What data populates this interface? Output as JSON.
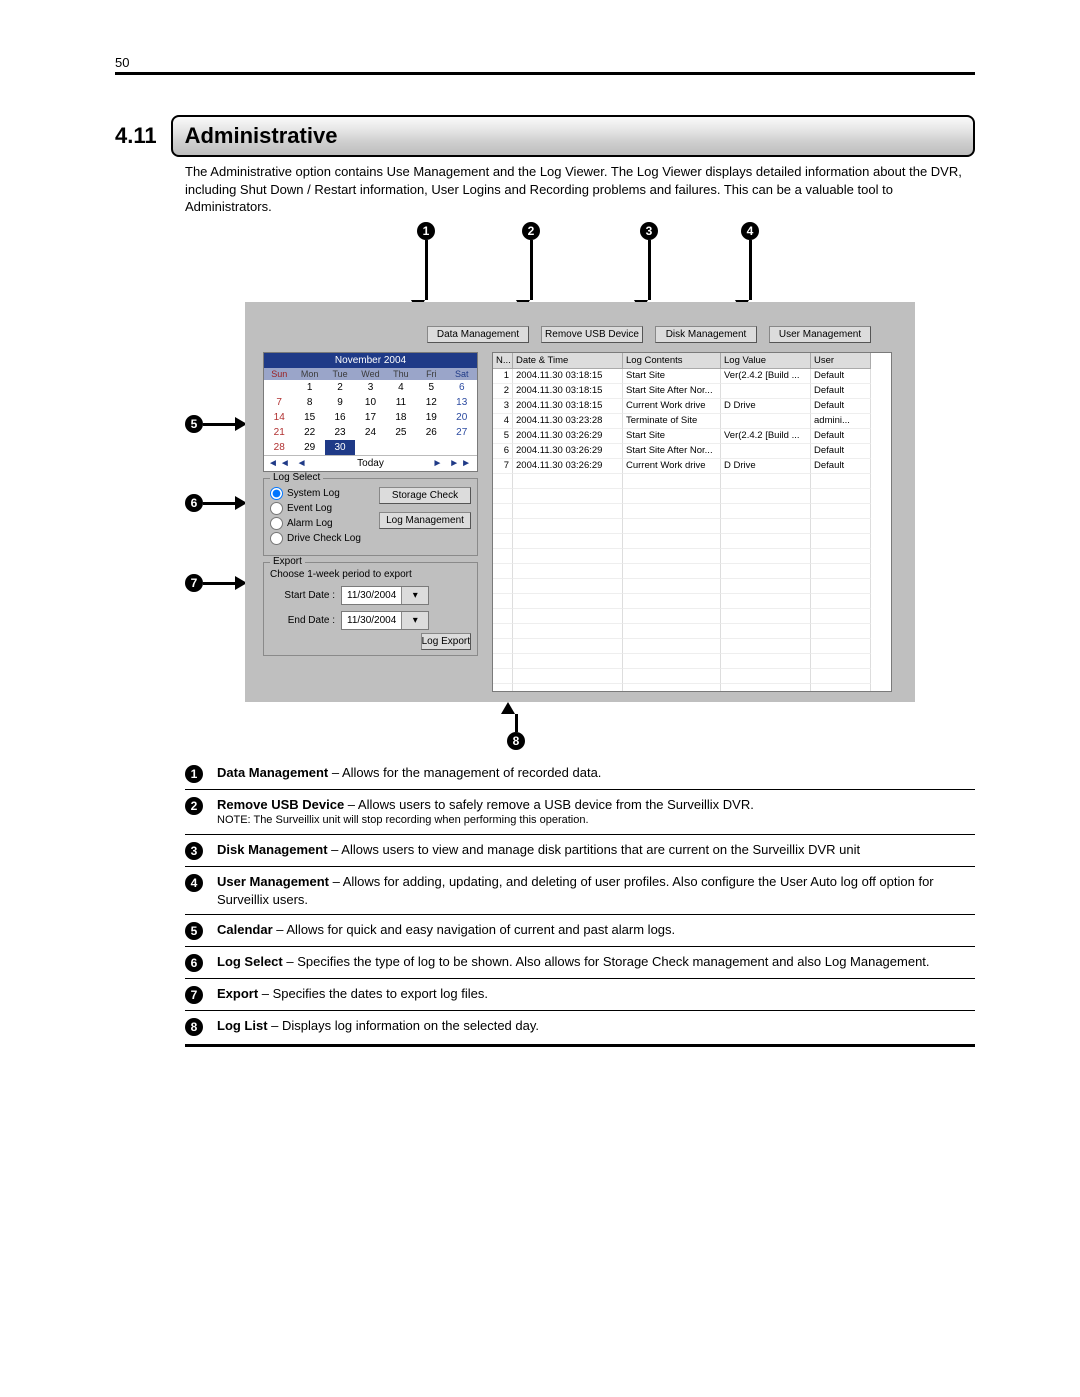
{
  "page_number": "50",
  "heading": {
    "num": "4.11",
    "title": "Administrative"
  },
  "intro": "The Administrative option contains Use Management and the Log Viewer. The Log Viewer displays detailed information about the DVR, including Shut Down / Restart information, User Logins and Recording problems and failures. This can be a valuable tool to Administrators.",
  "callouts_top": [
    "1",
    "2",
    "3",
    "4"
  ],
  "callouts_left": [
    "5",
    "6",
    "7"
  ],
  "callout_bottom": "8",
  "top_buttons": [
    "Data Management",
    "Remove USB Device",
    "Disk Management",
    "User Management"
  ],
  "calendar": {
    "title": "November 2004",
    "dow": [
      "Sun",
      "Mon",
      "Tue",
      "Wed",
      "Thu",
      "Fri",
      "Sat"
    ],
    "rows": [
      [
        "",
        "1",
        "2",
        "3",
        "4",
        "5",
        "6"
      ],
      [
        "7",
        "8",
        "9",
        "10",
        "11",
        "12",
        "13"
      ],
      [
        "14",
        "15",
        "16",
        "17",
        "18",
        "19",
        "20"
      ],
      [
        "21",
        "22",
        "23",
        "24",
        "25",
        "26",
        "27"
      ],
      [
        "28",
        "29",
        "30",
        "",
        "",
        "",
        ""
      ]
    ],
    "selected": "30",
    "today_label": "Today"
  },
  "log_select": {
    "title": "Log Select",
    "options": [
      "System Log",
      "Event Log",
      "Alarm Log",
      "Drive Check Log"
    ],
    "selected": "System Log",
    "buttons": [
      "Storage Check",
      "Log Management"
    ]
  },
  "export": {
    "title": "Export",
    "hint": "Choose 1-week period to export",
    "start_label": "Start Date :",
    "end_label": "End Date :",
    "start_value": "11/30/2004",
    "end_value": "11/30/2004",
    "button": "Log Export"
  },
  "table": {
    "headers": [
      "N...",
      "Date & Time",
      "Log Contents",
      "Log Value",
      "User"
    ],
    "rows": [
      [
        "1",
        "2004.11.30 03:18:15",
        "Start Site",
        "Ver(2.4.2 [Build ...",
        "Default"
      ],
      [
        "2",
        "2004.11.30 03:18:15",
        "Start Site After Nor...",
        "",
        "Default"
      ],
      [
        "3",
        "2004.11.30 03:18:15",
        "Current Work drive",
        "D Drive",
        "Default"
      ],
      [
        "4",
        "2004.11.30 03:23:28",
        "Terminate of Site",
        "",
        "admini..."
      ],
      [
        "5",
        "2004.11.30 03:26:29",
        "Start Site",
        "Ver(2.4.2 [Build ...",
        "Default"
      ],
      [
        "6",
        "2004.11.30 03:26:29",
        "Start Site After Nor...",
        "",
        "Default"
      ],
      [
        "7",
        "2004.11.30 03:26:29",
        "Current Work drive",
        "D Drive",
        "Default"
      ]
    ],
    "blank_rows": 15
  },
  "legend": [
    {
      "n": "1",
      "b": "Data Management",
      "t": " – Allows for the management of recorded data."
    },
    {
      "n": "2",
      "b": "Remove USB Device",
      "t": " – Allows users to safely remove a USB device from the Surveillix DVR.",
      "note": "NOTE: The Surveillix unit will stop recording when performing this operation."
    },
    {
      "n": "3",
      "b": "Disk Management",
      "t": " – Allows users to view and manage disk partitions that are current on the Surveillix DVR unit"
    },
    {
      "n": "4",
      "b": "User Management",
      "t": " – Allows for adding, updating, and deleting of user profiles. Also configure the User Auto log off option for Surveillix users."
    },
    {
      "n": "5",
      "b": "Calendar",
      "t": " – Allows for quick and easy navigation of current and past alarm logs."
    },
    {
      "n": "6",
      "b": "Log Select",
      "t": " – Specifies the type of log to be shown. Also allows for Storage Check management and also Log Management."
    },
    {
      "n": "7",
      "b": "Export",
      "t": " – Specifies the dates to export log files."
    },
    {
      "n": "8",
      "b": "Log List",
      "t": " – Displays log information on the selected day."
    }
  ]
}
